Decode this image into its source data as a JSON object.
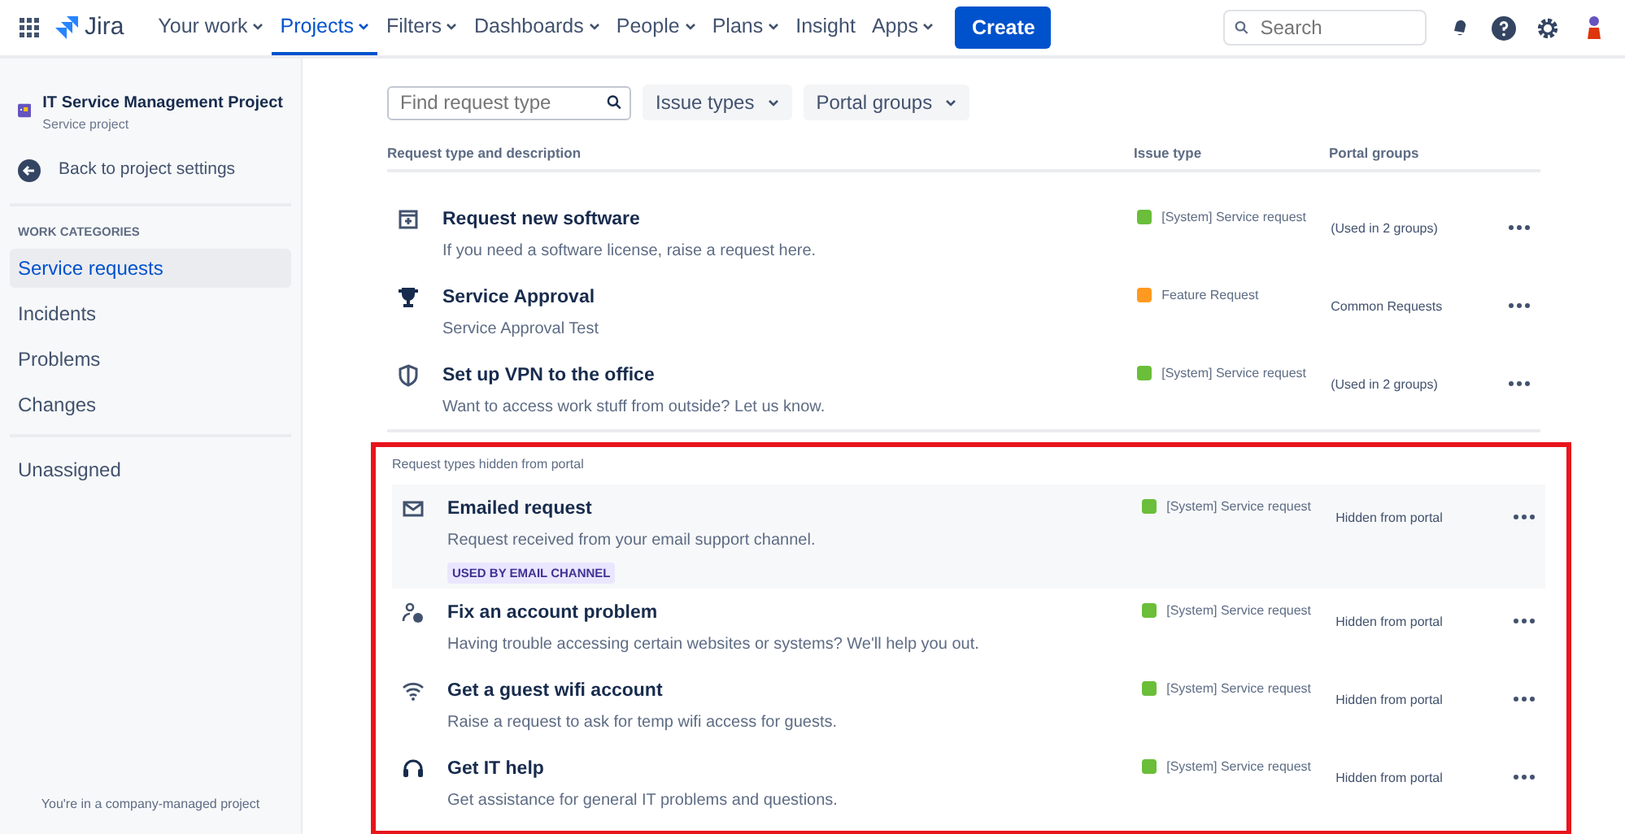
{
  "top_nav": {
    "product": "Jira",
    "items": [
      {
        "label": "Your work",
        "dropdown": true,
        "selected": false
      },
      {
        "label": "Projects",
        "dropdown": true,
        "selected": true
      },
      {
        "label": "Filters",
        "dropdown": true,
        "selected": false
      },
      {
        "label": "Dashboards",
        "dropdown": true,
        "selected": false
      },
      {
        "label": "People",
        "dropdown": true,
        "selected": false
      },
      {
        "label": "Plans",
        "dropdown": true,
        "selected": false
      },
      {
        "label": "Insight",
        "dropdown": false,
        "selected": false
      },
      {
        "label": "Apps",
        "dropdown": true,
        "selected": false
      }
    ],
    "create_button": "Create",
    "search": {
      "placeholder": "Search"
    }
  },
  "sidebar": {
    "project_name": "IT Service Management Project",
    "project_type": "Service project",
    "back_link": "Back to project settings",
    "section_title": "WORK CATEGORIES",
    "items": [
      {
        "label": "Service requests",
        "selected": true
      },
      {
        "label": "Incidents",
        "selected": false
      },
      {
        "label": "Problems",
        "selected": false
      },
      {
        "label": "Changes",
        "selected": false
      }
    ],
    "extra_items": [
      {
        "label": "Unassigned",
        "selected": false
      }
    ],
    "footer": "You're in a company-managed project"
  },
  "filters": {
    "search": {
      "placeholder": "Find request type"
    },
    "buttons": [
      "Issue types",
      "Portal groups"
    ]
  },
  "table": {
    "columns": [
      "Request type and description",
      "Issue type",
      "Portal groups"
    ],
    "rows": [
      {
        "kind": "form",
        "name": "Request new software",
        "description": "If you need a software license, raise a request here.",
        "issue_type": "[System] Service request",
        "color": "#6abe39",
        "portal_groups": "(Used in 2 groups)"
      },
      {
        "kind": "trophy",
        "name": "Service Approval",
        "description": "Service Approval Test",
        "issue_type": "Feature Request",
        "color": "#ff991f",
        "portal_groups": "Common Requests"
      },
      {
        "kind": "shield",
        "name": "Set up VPN to the office",
        "description": "Want to access work stuff from outside? Let us know.",
        "issue_type": "[System] Service request",
        "color": "#6abe39",
        "portal_groups": "(Used in 2 groups)"
      }
    ]
  },
  "hidden_section": {
    "title": "Request types hidden from portal",
    "highlighted": true,
    "rows": [
      {
        "kind": "mail",
        "name": "Emailed request",
        "description": "Request received from your email support channel.",
        "tag": "USED BY EMAIL CHANNEL",
        "issue_type": "[System] Service request",
        "color": "#6abe39",
        "portal_groups": "Hidden from portal",
        "selected": true
      },
      {
        "kind": "person",
        "name": "Fix an account problem",
        "description": "Having trouble accessing certain websites or systems? We'll help you out.",
        "issue_type": "[System] Service request",
        "color": "#6abe39",
        "portal_groups": "Hidden from portal",
        "selected": false
      },
      {
        "kind": "wifi",
        "name": "Get a guest wifi account",
        "description": "Raise a request to ask for temp wifi access for guests.",
        "issue_type": "[System] Service request",
        "color": "#6abe39",
        "portal_groups": "Hidden from portal",
        "selected": false
      },
      {
        "kind": "headset",
        "name": "Get IT help",
        "description": "Get assistance for general IT problems and questions.",
        "issue_type": "[System] Service request",
        "color": "#6abe39",
        "portal_groups": "Hidden from portal",
        "selected": false
      }
    ]
  }
}
